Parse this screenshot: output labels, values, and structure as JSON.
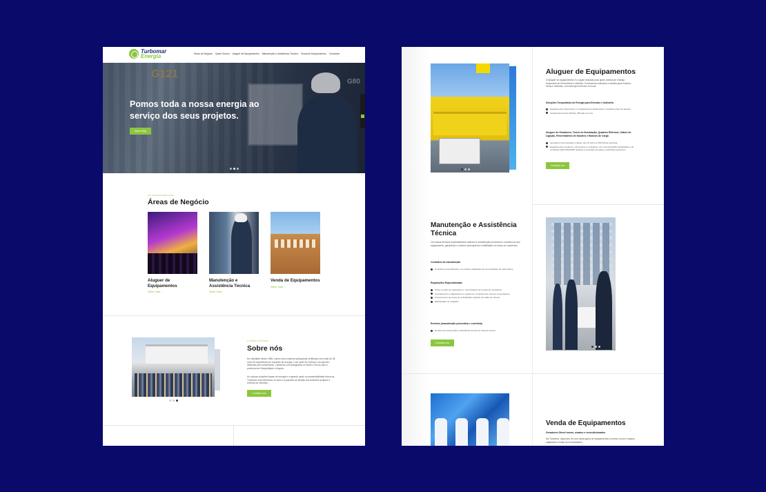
{
  "left": {
    "logo": {
      "line1": "Turbomar",
      "line2": "Energia"
    },
    "nav": [
      "Áreas de Negócio",
      "Quem Somos",
      "Aluguer de Equipamentos",
      "Manutenção e Assistência Técnica",
      "Venda de Equipamentos",
      "Contactos"
    ],
    "hero": {
      "title": "Pomos toda a nossa energia ao serviço dos seus projetos.",
      "button": "Saber Mais",
      "side_tab": "Contactos",
      "bg_text_1": "G121",
      "bg_text_2": "G80"
    },
    "areas": {
      "eyebrow": "OS NOSSOS SERVIÇOS",
      "title": "Áreas de Negócio",
      "cards": [
        {
          "title": "Aluguer de Equipamentos",
          "link": "Saber Mais →"
        },
        {
          "title": "Manutenção e Assistência Técnica",
          "link": "Saber Mais →"
        },
        {
          "title": "Venda de Equipamentos",
          "link": "Saber Mais →"
        }
      ]
    },
    "about": {
      "eyebrow": "A NOSSA HISTÓRIA",
      "title": "Sobre nós",
      "p1": "Em atividade desde 1985, somos uma empresa portuguesa certificada com mais de 35 anos de experiência em soluções de energia. Com sede em Lisboa e um parceiro dedicado pelo crescimento, contamos com delegações no Norte e Sul do país e presença em Moçambique e Angola.",
      "p2": "Ao colocar soluções limpas de energia e a garantir apoio na sustentabilidade futura da Turbomar uma referência no setor e a parceira de eleição dos melhores projetos e eventos do mercado.",
      "button": "Contacte-nos"
    }
  },
  "right": {
    "aluguer": {
      "title": "Aluguer de Equipamentos",
      "p": "O aluguer de equipamentos é a opção indicada para quem precisa de energia temporária de forma fiável e eficiente. Fornecemos soluções à medida para eventos, obras e indústria, com total apoio técnico no local.",
      "sub1": "Soluções Temporárias de Energia para Eventos e Indústria",
      "list1": [
        "Equipamentos disponíveis e completamente abastecidos e testados antes do aluguer.",
        "Assistência técnica 24h/dia, 365 dias por ano."
      ],
      "sub2": "Aluguer de Geradores, Torres de Iluminação, Quadros Elétricos, Cabos de Ligação, Reservatórios de Gasóleo e Bancos de Carga",
      "list2": [
        "Geradores insonorizados a diesel, dos 10 kVA a 1.250 kVA de potência.",
        "Equipamentos modernos, silenciosos e ecológicos, com normas EURO atualizadas e de confiança (UE) 2016/1628 relativas a emissões de gases e partículas poluentes."
      ],
      "button": "Contacte-nos"
    },
    "manutencao": {
      "title": "Manutenção e Assistência Técnica",
      "p": "Os nossos técnicos especializados realizam a manutenção preventiva e corretiva do seu equipamento, garantindo o máximo desempenho e fiabilidade em todos os momentos.",
      "sub1": "Contratos de manutenção",
      "list1": [
        "Contratos personalizados, com planos adaptados às necessidades de cada cliente."
      ],
      "sub2": "Reparações Especializadas",
      "list2": [
        "Todos os tipos de reparações e motorizações de Grupos de Geradores.",
        "Levantamento e diagnóstico no quadro de comando dos motores de geradores.",
        "Fornecimento de peças de substituição originais de todas as marcas.",
        "Eletrificação de unidades."
      ],
      "sub3": "Eventos (manutenção preventiva e corretiva)",
      "list3": [
        "Serviço de manutenção e assistência técnica no local do evento."
      ],
      "button": "Contacte-nos"
    },
    "venda": {
      "title": "Venda de Equipamentos",
      "sub": "Geradores Diesel novos, usados e recondicionados",
      "p": "Na Turbomar, dispomos de uma vasta gama de equipamentos a venda, novos e usados, adaptados a todas as necessidades."
    }
  }
}
